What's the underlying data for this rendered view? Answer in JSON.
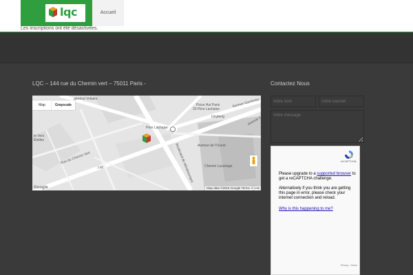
{
  "header": {
    "logo_text": "lqc",
    "nav_home": "Accueil",
    "notice": "Les inscriptions ont été désactivées."
  },
  "footer": {
    "address": "LQC – 144 rue du Chemin vert – 75011 Paris -",
    "contact_title": "Contactez Nous",
    "name_placeholder": "Votre nom",
    "email_placeholder": "Votre courriel",
    "message_placeholder": "Votre message"
  },
  "map": {
    "tab_map": "Map",
    "tab_grayscale": "Grayscale",
    "streets": {
      "general_voltaire": "général Voltaire",
      "pizza_hut": "Pizza Hut Paris",
      "pere_lachaise_20": "20 Père Lachaise",
      "avenue_gambetta": "Avenue Gambetta",
      "unyberg": "Unyberg",
      "pere_lachaise": "Père Lachaise",
      "chemin_vert": "Rue du Chemin Vert",
      "avenue_ouest": "Avenue de l'Ouest",
      "chemin_lucarlage": "Chemin Lucarlage",
      "bd_menilmontant": "Boulevard de Ménilmontant",
      "lidl": "Lidl",
      "le_vers": "le Vers",
      "etoiles": "Étoiles",
      "avenue_c": "Avenue C"
    },
    "zoom_in": "+",
    "zoom_out": "−",
    "footer": "Map data ©2016 Google    Terms of Use",
    "google": "Google"
  },
  "recaptcha": {
    "brand": "reCAPTCHA",
    "msg_prefix": "Please upgrade to a ",
    "msg_link": "supported browser",
    "msg_suffix": " to get a reCAPTCHA challenge.",
    "msg2": "Alternatively if you think you are getting this page in error, please check your internet connection and reload.",
    "why": "Why is this happening to me?",
    "privacy": "Privacy - Terms"
  },
  "colors": {
    "brand_green": "#2e9e3e",
    "footer_bg": "#3a3a3a"
  }
}
